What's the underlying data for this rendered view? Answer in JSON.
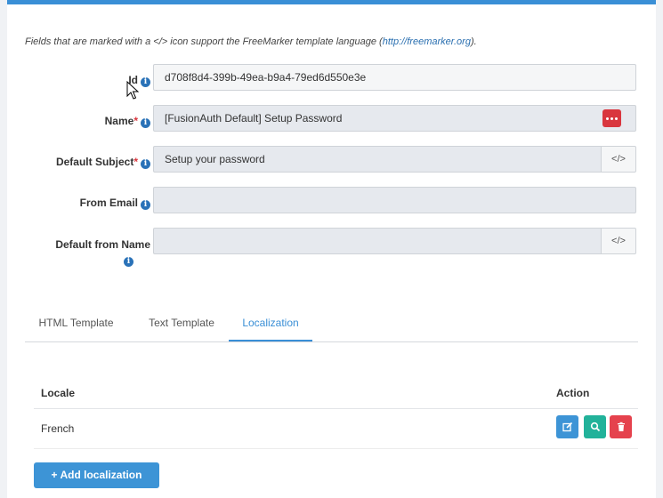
{
  "help": {
    "prefix": "Fields that are marked with a </> icon support the FreeMarker template language (",
    "link": "http://freemarker.org",
    "suffix": ")."
  },
  "form": {
    "id": {
      "label": "Id",
      "value": "d708f8d4-399b-49ea-b9a4-79ed6d550e3e"
    },
    "name": {
      "label": "Name",
      "required_mark": "*",
      "value": "[FusionAuth Default] Setup Password"
    },
    "default_subject": {
      "label": "Default Subject",
      "required_mark": "*",
      "value": "Setup your password",
      "addon": "</>"
    },
    "from_email": {
      "label": "From Email",
      "value": ""
    },
    "default_from_name": {
      "label": "Default from Name",
      "value": "",
      "addon": "</>"
    }
  },
  "tabs": [
    {
      "label": "HTML Template",
      "active": false
    },
    {
      "label": "Text Template",
      "active": false
    },
    {
      "label": "Localization",
      "active": true
    }
  ],
  "localization_table": {
    "headers": {
      "locale": "Locale",
      "action": "Action"
    },
    "rows": [
      {
        "locale": "French"
      }
    ]
  },
  "add_button": {
    "label": "+ Add localization"
  },
  "colors": {
    "accent": "#3a8fd6",
    "danger": "#e5424d",
    "success": "#22b29a"
  },
  "icons": {
    "info": "info-circle-icon",
    "code": "code-icon",
    "password_generator": "ellipsis-icon",
    "edit": "edit-icon",
    "view": "search-icon",
    "delete": "trash-icon"
  }
}
